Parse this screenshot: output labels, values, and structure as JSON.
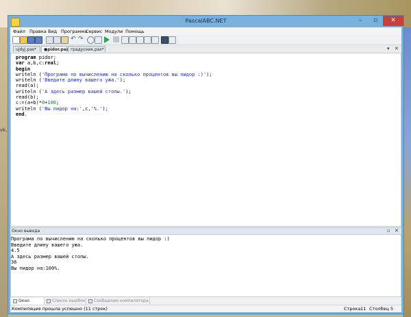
{
  "window": {
    "title": "PascalABC.NET"
  },
  "menu": [
    "Файл",
    "Правка",
    "Вид",
    "Программа",
    "Сервис",
    "Модули",
    "Помощь"
  ],
  "toolbar": {
    "icons": [
      "new-file-icon",
      "open-icon",
      "save-icon",
      "save-all-icon",
      "cut-icon",
      "copy-icon",
      "paste-icon",
      "undo-icon",
      "redo-icon",
      "search-icon",
      "replace-icon",
      "run-icon",
      "stop-icon",
      "compile-icon",
      "step-over-icon",
      "step-into-icon",
      "step-out-icon",
      "breakpoint-icon",
      "output-window-icon",
      "form-designer-icon"
    ]
  },
  "tabs": [
    {
      "label": "ujdyj.pas*",
      "active": false
    },
    {
      "label": "●pidor.pas*",
      "active": true
    },
    {
      "label": "градусник.pas*",
      "active": false
    }
  ],
  "editor": {
    "lines": [
      [
        {
          "t": "program",
          "c": "kw"
        },
        {
          "t": " pidor;",
          "c": ""
        }
      ],
      [
        {
          "t": "var",
          "c": "kw"
        },
        {
          "t": " a,b,c:",
          "c": ""
        },
        {
          "t": "real",
          "c": "kw"
        },
        {
          "t": ";",
          "c": ""
        }
      ],
      [
        {
          "t": "begin",
          "c": "kw"
        }
      ],
      [
        {
          "t": "writeln (",
          "c": ""
        },
        {
          "t": "'Програма по вычислению на сколько процентов вы пидор :)'",
          "c": "str"
        },
        {
          "t": ");",
          "c": ""
        }
      ],
      [
        {
          "t": "writeln (",
          "c": ""
        },
        {
          "t": "'Введите длину вашего ужа.'",
          "c": "str"
        },
        {
          "t": ");",
          "c": ""
        }
      ],
      [
        {
          "t": "read(a);",
          "c": ""
        }
      ],
      [
        {
          "t": "writeln (",
          "c": ""
        },
        {
          "t": "'А здесь размер вашей стопы.'",
          "c": "str"
        },
        {
          "t": ");",
          "c": ""
        }
      ],
      [
        {
          "t": "read(b);",
          "c": ""
        }
      ],
      [
        {
          "t": "c:=(a+b)*",
          "c": ""
        },
        {
          "t": "0",
          "c": "num"
        },
        {
          "t": "+",
          "c": ""
        },
        {
          "t": "100",
          "c": "num"
        },
        {
          "t": ";",
          "c": ""
        }
      ],
      [
        {
          "t": "writeln (",
          "c": ""
        },
        {
          "t": "'Вы пидор на:'",
          "c": "str"
        },
        {
          "t": ",c,",
          "c": ""
        },
        {
          "t": "'%.'",
          "c": "str"
        },
        {
          "t": ");",
          "c": ""
        }
      ],
      [
        {
          "t": "end",
          "c": "kw"
        },
        {
          "t": ".",
          "c": ""
        }
      ]
    ]
  },
  "output_panel": {
    "title": "Окно вывода",
    "lines": [
      "Програма по вычислению на сколько процентов вы пидор :)",
      "Введите длину вашего ужа.",
      "4.5",
      "А здесь размер вашей стопы.",
      "36",
      "Вы пидор на:100%."
    ]
  },
  "bottom_tabs": [
    {
      "label": "Окно вывода",
      "active": true
    },
    {
      "label": "Список ошибок",
      "active": false
    },
    {
      "label": "Сообщения компилятора",
      "active": false
    }
  ],
  "status": {
    "message": "Компиляция прошла успешно (11 строк)",
    "row_label": "Строка",
    "row": "11",
    "col_label": "Столбец",
    "col": "5"
  },
  "desktop": {
    "side_text": "vk."
  },
  "colors": {
    "title_bar": "#7ab0dc",
    "close_button": "#c6413b",
    "keyword": "#000000",
    "string": "#1a2fb0",
    "number": "#0a7a30"
  }
}
